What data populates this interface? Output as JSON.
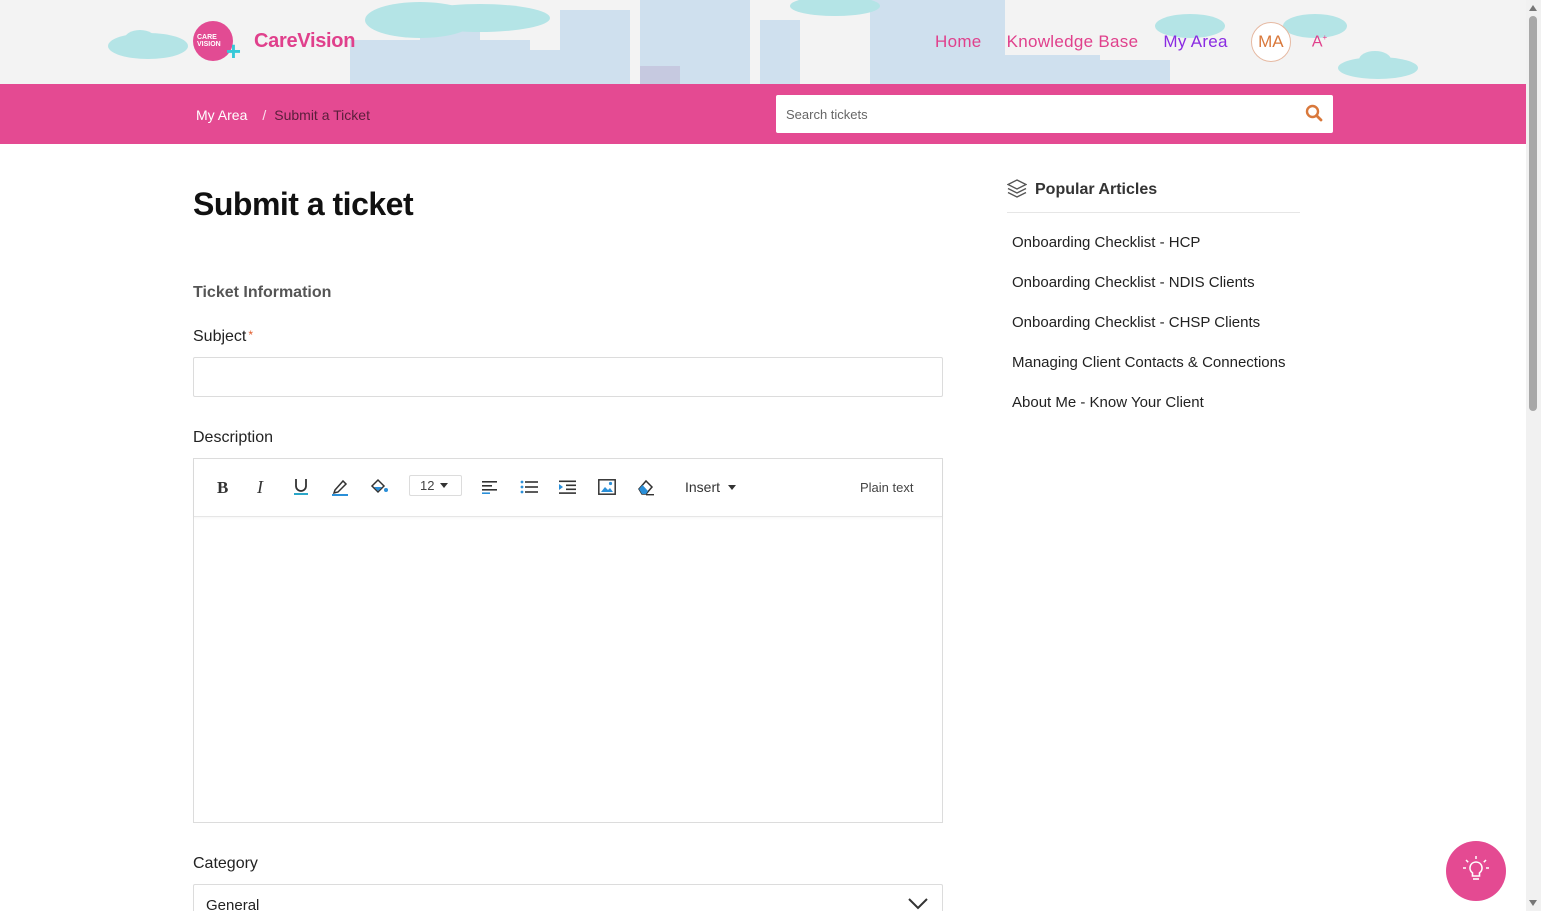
{
  "brand": {
    "name": "CareVision",
    "badge_line1": "CARE",
    "badge_line2": "VISION"
  },
  "nav": {
    "items": [
      {
        "label": "Home"
      },
      {
        "label": "Knowledge Base"
      },
      {
        "label": "My Area"
      }
    ],
    "avatar_initials": "MA",
    "font_toggle": "A",
    "font_toggle_sup": "+"
  },
  "breadcrumb": {
    "root": "My Area",
    "separator": "/",
    "current": "Submit a Ticket"
  },
  "search": {
    "placeholder": "Search tickets",
    "value": ""
  },
  "page": {
    "title": "Submit a ticket",
    "section_title": "Ticket Information"
  },
  "form": {
    "subject_label": "Subject",
    "required_mark": "*",
    "subject_value": "",
    "description_label": "Description",
    "editor": {
      "font_size": "12",
      "insert_label": "Insert",
      "plain_text_label": "Plain text",
      "tools": [
        "bold-icon",
        "italic-icon",
        "underline-icon",
        "text-color-icon",
        "fill-color-icon",
        "align-left-icon",
        "bullet-list-icon",
        "indent-icon",
        "image-icon",
        "eraser-icon"
      ]
    },
    "category_label": "Category",
    "category_value": "General"
  },
  "sidebar": {
    "title": "Popular Articles",
    "articles": [
      {
        "title": "Onboarding Checklist - HCP"
      },
      {
        "title": "Onboarding Checklist - NDIS Clients"
      },
      {
        "title": "Onboarding Checklist - CHSP Clients"
      },
      {
        "title": "Managing Client Contacts & Connections"
      },
      {
        "title": "About Me - Know Your Client"
      }
    ]
  },
  "colors": {
    "brand_pink": "#e44a92",
    "nav_active": "#8a2be2",
    "accent_orange": "#d9783b",
    "logo_plus": "#36c9d8"
  }
}
